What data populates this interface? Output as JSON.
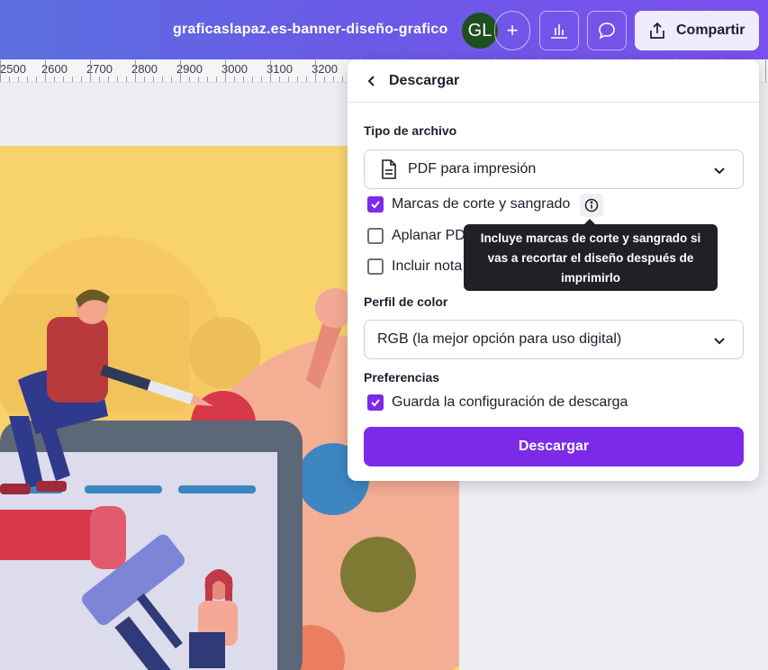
{
  "header": {
    "doc_title": "graficaslapaz.es-banner-diseño-grafico",
    "avatar_initials": "GL",
    "add_symbol": "+",
    "share_label": "Compartir"
  },
  "ruler": {
    "labels": [
      "2500",
      "2600",
      "2700",
      "2800",
      "2900",
      "3000",
      "3100",
      "3200"
    ]
  },
  "panel": {
    "title": "Descargar",
    "file_type_label": "Tipo de archivo",
    "file_type_value": "PDF para impresión",
    "options": [
      {
        "label": "Marcas de corte y sangrado",
        "checked": true
      },
      {
        "label": "Aplanar PD",
        "checked": false
      },
      {
        "label": "Incluir nota",
        "checked": false
      }
    ],
    "color_profile_label": "Perfil de color",
    "color_profile_value": "RGB (la mejor opción para uso digital)",
    "preferences_label": "Preferencias",
    "save_settings_label": "Guarda la configuración de descarga",
    "save_settings_checked": true,
    "download_button": "Descargar"
  },
  "tooltip": {
    "line1": "Incluye marcas de corte y sangrado si",
    "line2": "vas a recortar el diseño después de",
    "line3": "imprimirlo"
  },
  "colors": {
    "accent": "#7d2ae8",
    "topbar_start": "#5a6fe0",
    "topbar_end": "#7b4fee",
    "canvas_bg": "#f8d36c",
    "tooltip_bg": "#1f2127"
  }
}
